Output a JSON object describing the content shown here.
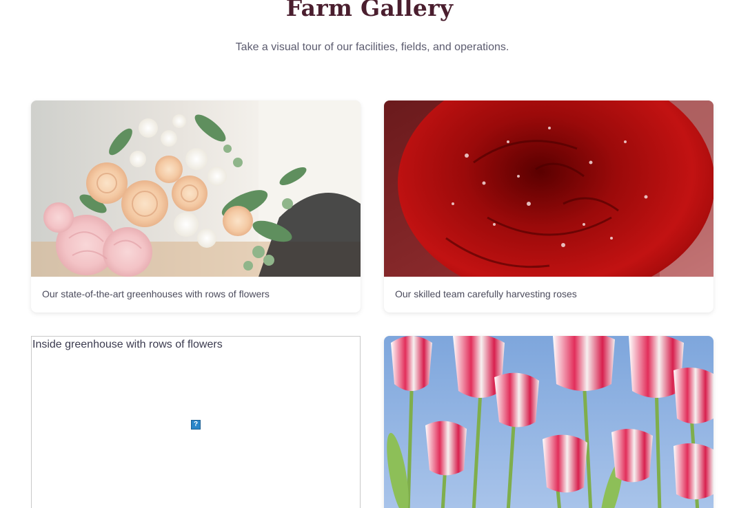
{
  "header": {
    "title": "Farm Gallery",
    "subtitle": "Take a visual tour of our facilities, fields, and operations."
  },
  "gallery": {
    "items": [
      {
        "caption": "Our state-of-the-art greenhouses with rows of flowers",
        "image": "flower-bouquet-photo"
      },
      {
        "caption": "Our skilled team carefully harvesting roses",
        "image": "red-rose-photo"
      },
      {
        "alt": "Inside greenhouse with rows of flowers",
        "image": "broken-image",
        "icon": "?"
      },
      {
        "image": "tulips-photo"
      }
    ]
  },
  "colors": {
    "title": "#4a1e2e",
    "subtitle": "#5b5b6e",
    "caption": "#4b4b5c",
    "broken_icon": "#2a86c9"
  }
}
